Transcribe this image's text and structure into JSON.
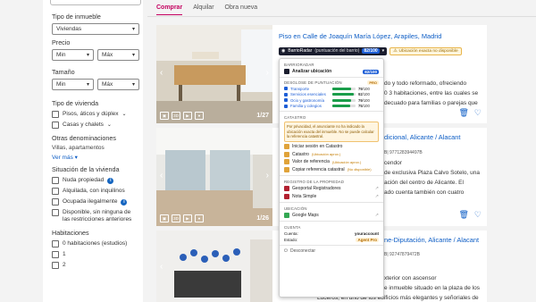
{
  "tabs": [
    {
      "label": "Comprar",
      "active": true
    },
    {
      "label": "Alquilar",
      "active": false
    },
    {
      "label": "Obra nueva",
      "active": false
    }
  ],
  "sidebar": {
    "tipo_inmueble_label": "Tipo de inmueble",
    "tipo_inmueble_value": "Viviendas",
    "precio_label": "Precio",
    "precio_min": "Min",
    "precio_max": "Máx",
    "tamano_label": "Tamaño",
    "tamano_min": "Min",
    "tamano_max": "Máx",
    "tipo_vivienda_label": "Tipo de vivienda",
    "tipo_vivienda_options": [
      "Pisos, áticos y dúplex",
      "Casas y chalets"
    ],
    "otras_label": "Otras denominaciones",
    "otras_value": "Villas, apartamentos",
    "ver_mas": "Ver más",
    "situacion_label": "Situación de la vivienda",
    "situacion_options": [
      "Nuda propiedad",
      "Alquilada, con inquilinos",
      "Ocupada ilegalmente",
      "Disponible, sin ninguna de las restricciones anteriores"
    ],
    "habitaciones_label": "Habitaciones",
    "habitaciones_options": [
      "0 habitaciones (estudios)",
      "1",
      "2"
    ]
  },
  "listings": [
    {
      "title": "Piso en Calle de Joaquín María López, Arapiles, Madrid",
      "photo_count": "1/27",
      "text1": "do y todo reformado, ofreciendo",
      "text2": "0 3 habitaciones, entre las cuales se",
      "text3": "decuado para familias o parejas que"
    },
    {
      "title": "dicional, Alicante / Alacant",
      "photo_count": "1/26",
      "ref": "977128394497B",
      "text1": "cendor",
      "text2": "de exclusiva Plaza Calvo Sotelo, una",
      "text3": "ación del centro de Alicante. El",
      "text4": "ado cuenta también con cuatro"
    },
    {
      "title": "ne-Diputación, Alicante / Alacant",
      "ref": "92747879472B",
      "text1": "xterior con ascensor",
      "text2": "e inmueble situado en la plaza de los",
      "text3": "Luceros, en uno de los edificios más elegantes y señoriales de Alicante."
    }
  ],
  "overlay": {
    "brand": "BarrioRadar",
    "bar_label": "(puntuación del barrio)",
    "score": "82/100",
    "warning": "Ubicación exacta no disponible",
    "section_barrioradar": "BARRIORADAR",
    "analizar_label": "Analizar ubicación",
    "analizar_score": "82/100",
    "section_desglose": "DESGLOSE DE PUNTUACIÓN",
    "pro_badge": "PRO",
    "metrics": [
      {
        "label": "Transporte",
        "value": "79",
        "unit": "/100"
      },
      {
        "label": "Servicios esenciales",
        "value": "92",
        "unit": "/100"
      },
      {
        "label": "Ocio y gastronomía",
        "value": "79",
        "unit": "/100"
      },
      {
        "label": "Familia y colegios",
        "value": "75",
        "unit": "/100"
      }
    ],
    "section_catastro": "CATASTRO",
    "catastro_note": "Por privacidad, el anunciante no ha indicado la ubicación exacta del inmueble. No se puede calcular la referencia catastral.",
    "catastro_items": [
      {
        "label": "Iniciar sesión en Catastro",
        "tag": ""
      },
      {
        "label": "Catastro",
        "tag": "(Ubicación aprox.)"
      },
      {
        "label": "Valor de referencia",
        "tag": "(Ubicación aprox.)"
      },
      {
        "label": "Copiar referencia catastral",
        "tag": "(No disponible)"
      }
    ],
    "section_registro": "REGISTRO DE LA PROPIEDAD",
    "registro_items": [
      "Geoportal Registradores",
      "Nota Simple"
    ],
    "section_ubicacion": "UBICACIÓN",
    "ubicacion_items": [
      "Google Maps"
    ],
    "section_cuenta": "CUENTA",
    "cuenta_label": "Cuenta:",
    "cuenta_value": "youraccount",
    "estado_label": "Estado:",
    "estado_value": "Agent Pro",
    "desconectar": "Desconectar"
  }
}
